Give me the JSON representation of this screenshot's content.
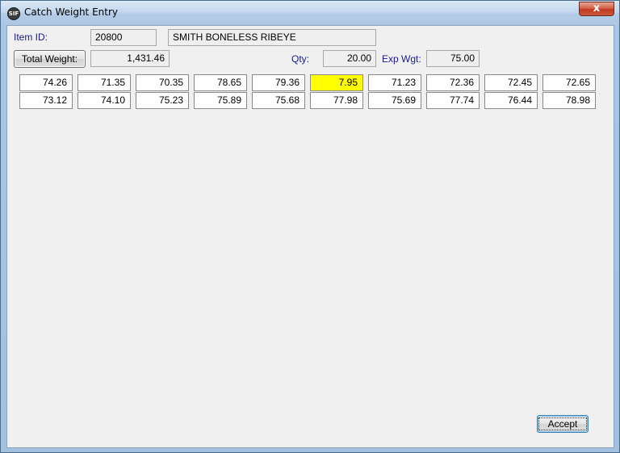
{
  "window": {
    "title": "Catch Weight Entry",
    "close_glyph": "x",
    "app_icon_text": "SIF"
  },
  "header": {
    "item_id_label": "Item ID:",
    "item_id_value": "20800",
    "item_description": "SMITH BONELESS RIBEYE",
    "total_weight_button": "Total Weight:",
    "total_weight_value": "1,431.46",
    "qty_label": "Qty:",
    "qty_value": "20.00",
    "exp_wgt_label": "Exp Wgt:",
    "exp_wgt_value": "75.00"
  },
  "weights": {
    "row1": [
      "74.26",
      "71.35",
      "70.35",
      "78.65",
      "79.36",
      "7.95",
      "71.23",
      "72.36",
      "72.45",
      "72.65"
    ],
    "row2": [
      "73.12",
      "74.10",
      "75.23",
      "75.89",
      "75.68",
      "77.98",
      "75.69",
      "77.74",
      "76.44",
      "78.98"
    ],
    "highlighted": {
      "row": 1,
      "col": 6
    },
    "highlight_color": "#ffff00"
  },
  "footer": {
    "accept_button": "Accept"
  }
}
